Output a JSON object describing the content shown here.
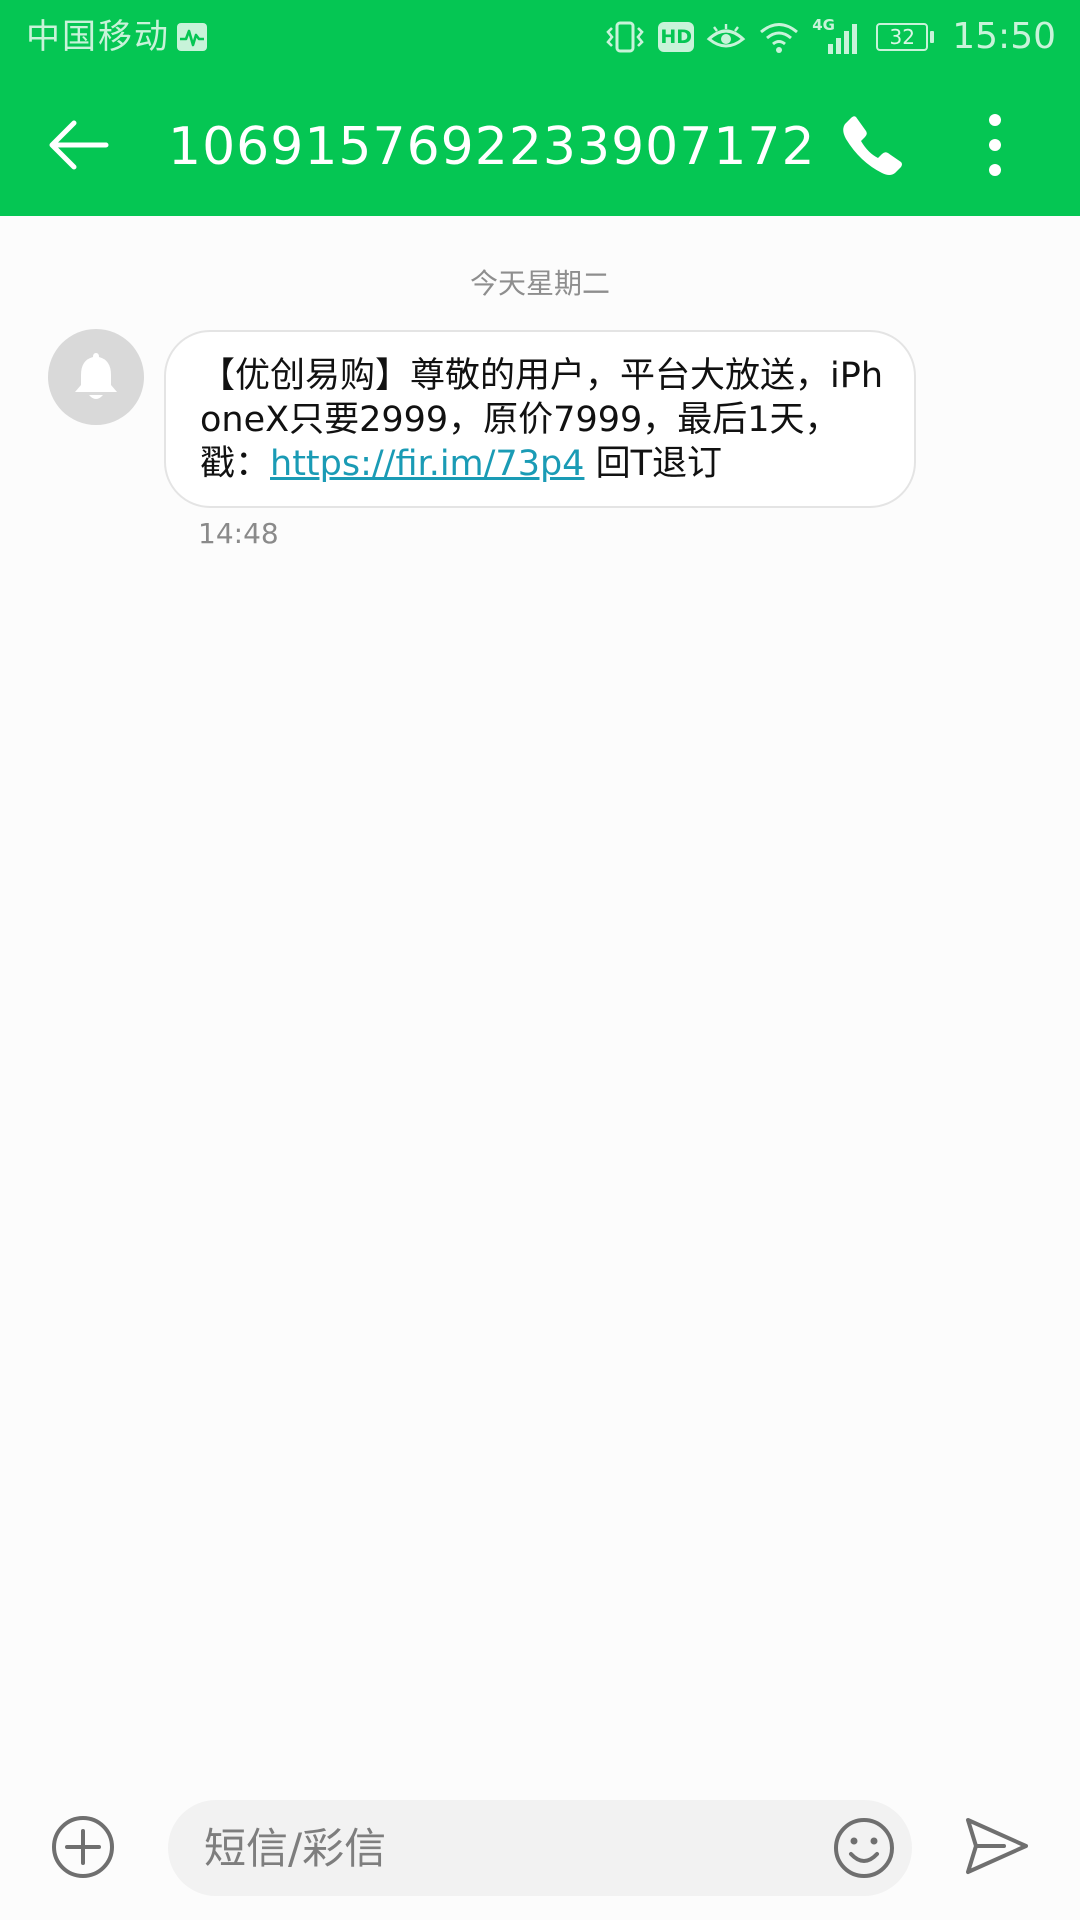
{
  "status_bar": {
    "carrier": "中国移动",
    "hd_badge": "HD",
    "network_type": "4G",
    "battery_level": "32",
    "time": "15:50",
    "icons": [
      "activity-notification-icon",
      "vibrate-icon",
      "hd-icon",
      "eye-comfort-icon",
      "wifi-icon",
      "cellular-signal-icon",
      "battery-icon"
    ]
  },
  "header": {
    "title": "1069157692233907172",
    "back_icon": "arrow-left-icon",
    "call_icon": "phone-icon",
    "menu_icon": "more-vertical-icon"
  },
  "conversation": {
    "date_label": "今天星期二",
    "messages": [
      {
        "sender_avatar_icon": "bell-icon",
        "text_before_link": "【优创易购】尊敬的用户，平台大放送，iPhoneX只要2999，原价7999，最后1天，戳：",
        "link": "https://fir.im/73p4",
        "text_after_link": " 回T退订",
        "time": "14:48"
      }
    ]
  },
  "compose": {
    "placeholder": "短信/彩信",
    "attach_icon": "plus-circle-icon",
    "emoji_icon": "smiley-icon",
    "send_icon": "send-icon"
  },
  "colors": {
    "brand_green": "#05c653",
    "link": "#1a9bb5",
    "bubble_border": "#e4e4e4",
    "background": "#fcfcfc"
  }
}
